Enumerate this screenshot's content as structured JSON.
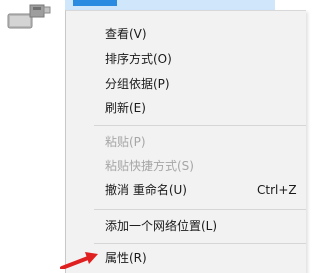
{
  "desktop": {
    "icon": "usb-drive-icon"
  },
  "context_menu": {
    "items": [
      {
        "label": "查看(V)",
        "enabled": true
      },
      {
        "label": "排序方式(O)",
        "enabled": true
      },
      {
        "label": "分组依据(P)",
        "enabled": true
      },
      {
        "label": "刷新(E)",
        "enabled": true
      },
      {
        "label": "粘贴(P)",
        "enabled": false
      },
      {
        "label": "粘贴快捷方式(S)",
        "enabled": false
      },
      {
        "label": "撤消 重命名(U)",
        "shortcut": "Ctrl+Z",
        "enabled": true
      },
      {
        "label": "添加一个网络位置(L)",
        "enabled": true
      },
      {
        "label": "属性(R)",
        "enabled": true
      }
    ]
  },
  "annotation": {
    "icon": "red-arrow-icon",
    "color": "#e02020"
  }
}
